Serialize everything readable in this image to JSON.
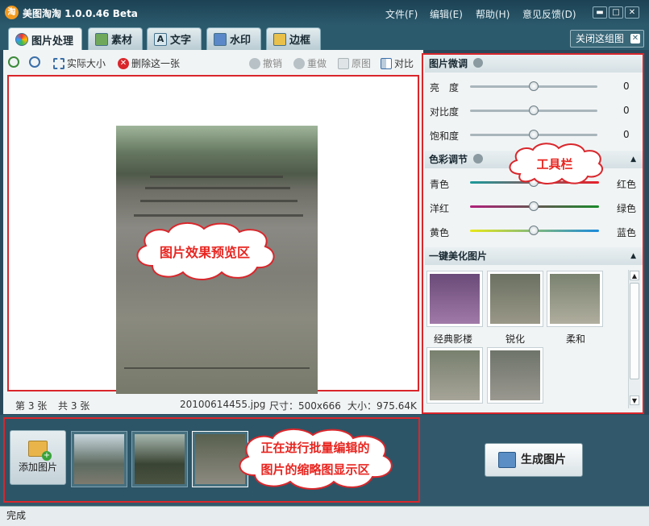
{
  "app": {
    "icon_char": "淘",
    "title": "美图淘淘 1.0.0.46 Beta"
  },
  "menu": {
    "file": "文件(F)",
    "edit": "编辑(E)",
    "help": "帮助(H)",
    "feedback": "意见反馈(D)"
  },
  "tabs": [
    "图片处理",
    "素材",
    "文字",
    "水印",
    "边框"
  ],
  "close_group": "关闭这组图",
  "toolbar": {
    "actual_size": "实际大小",
    "delete": "删除这一张",
    "undo": "撤销",
    "redo": "重做",
    "original": "原图",
    "compare": "对比"
  },
  "status": {
    "index": "第 3 张",
    "total": "共 3 张",
    "filename": "20100614455.jpg",
    "size": "尺寸：500x666",
    "filesize": "大小：975.64K"
  },
  "fine_tune": {
    "title": "图片微调",
    "items": [
      {
        "label": "亮　度",
        "value": "0"
      },
      {
        "label": "对比度",
        "value": "0"
      },
      {
        "label": "饱和度",
        "value": "0"
      }
    ]
  },
  "color_adjust": {
    "title": "色彩调节",
    "items": [
      {
        "left": "青色",
        "right": "红色"
      },
      {
        "left": "洋红",
        "right": "绿色"
      },
      {
        "left": "黄色",
        "right": "蓝色"
      }
    ]
  },
  "beautify": {
    "title": "一键美化图片",
    "items": [
      "经典影楼",
      "锐化",
      "柔和"
    ]
  },
  "callouts": {
    "preview": "图片效果预览区",
    "toolbar": "工具栏",
    "thumbs_line1": "正在进行批量编辑的",
    "thumbs_line2": "图片的缩略图显示区"
  },
  "add_image": "添加图片",
  "generate": "生成图片",
  "statusbar": "完成",
  "colors": {
    "accent_red": "#d9272c",
    "callout_text": "#e82520",
    "frame": "#2c5a6d"
  }
}
